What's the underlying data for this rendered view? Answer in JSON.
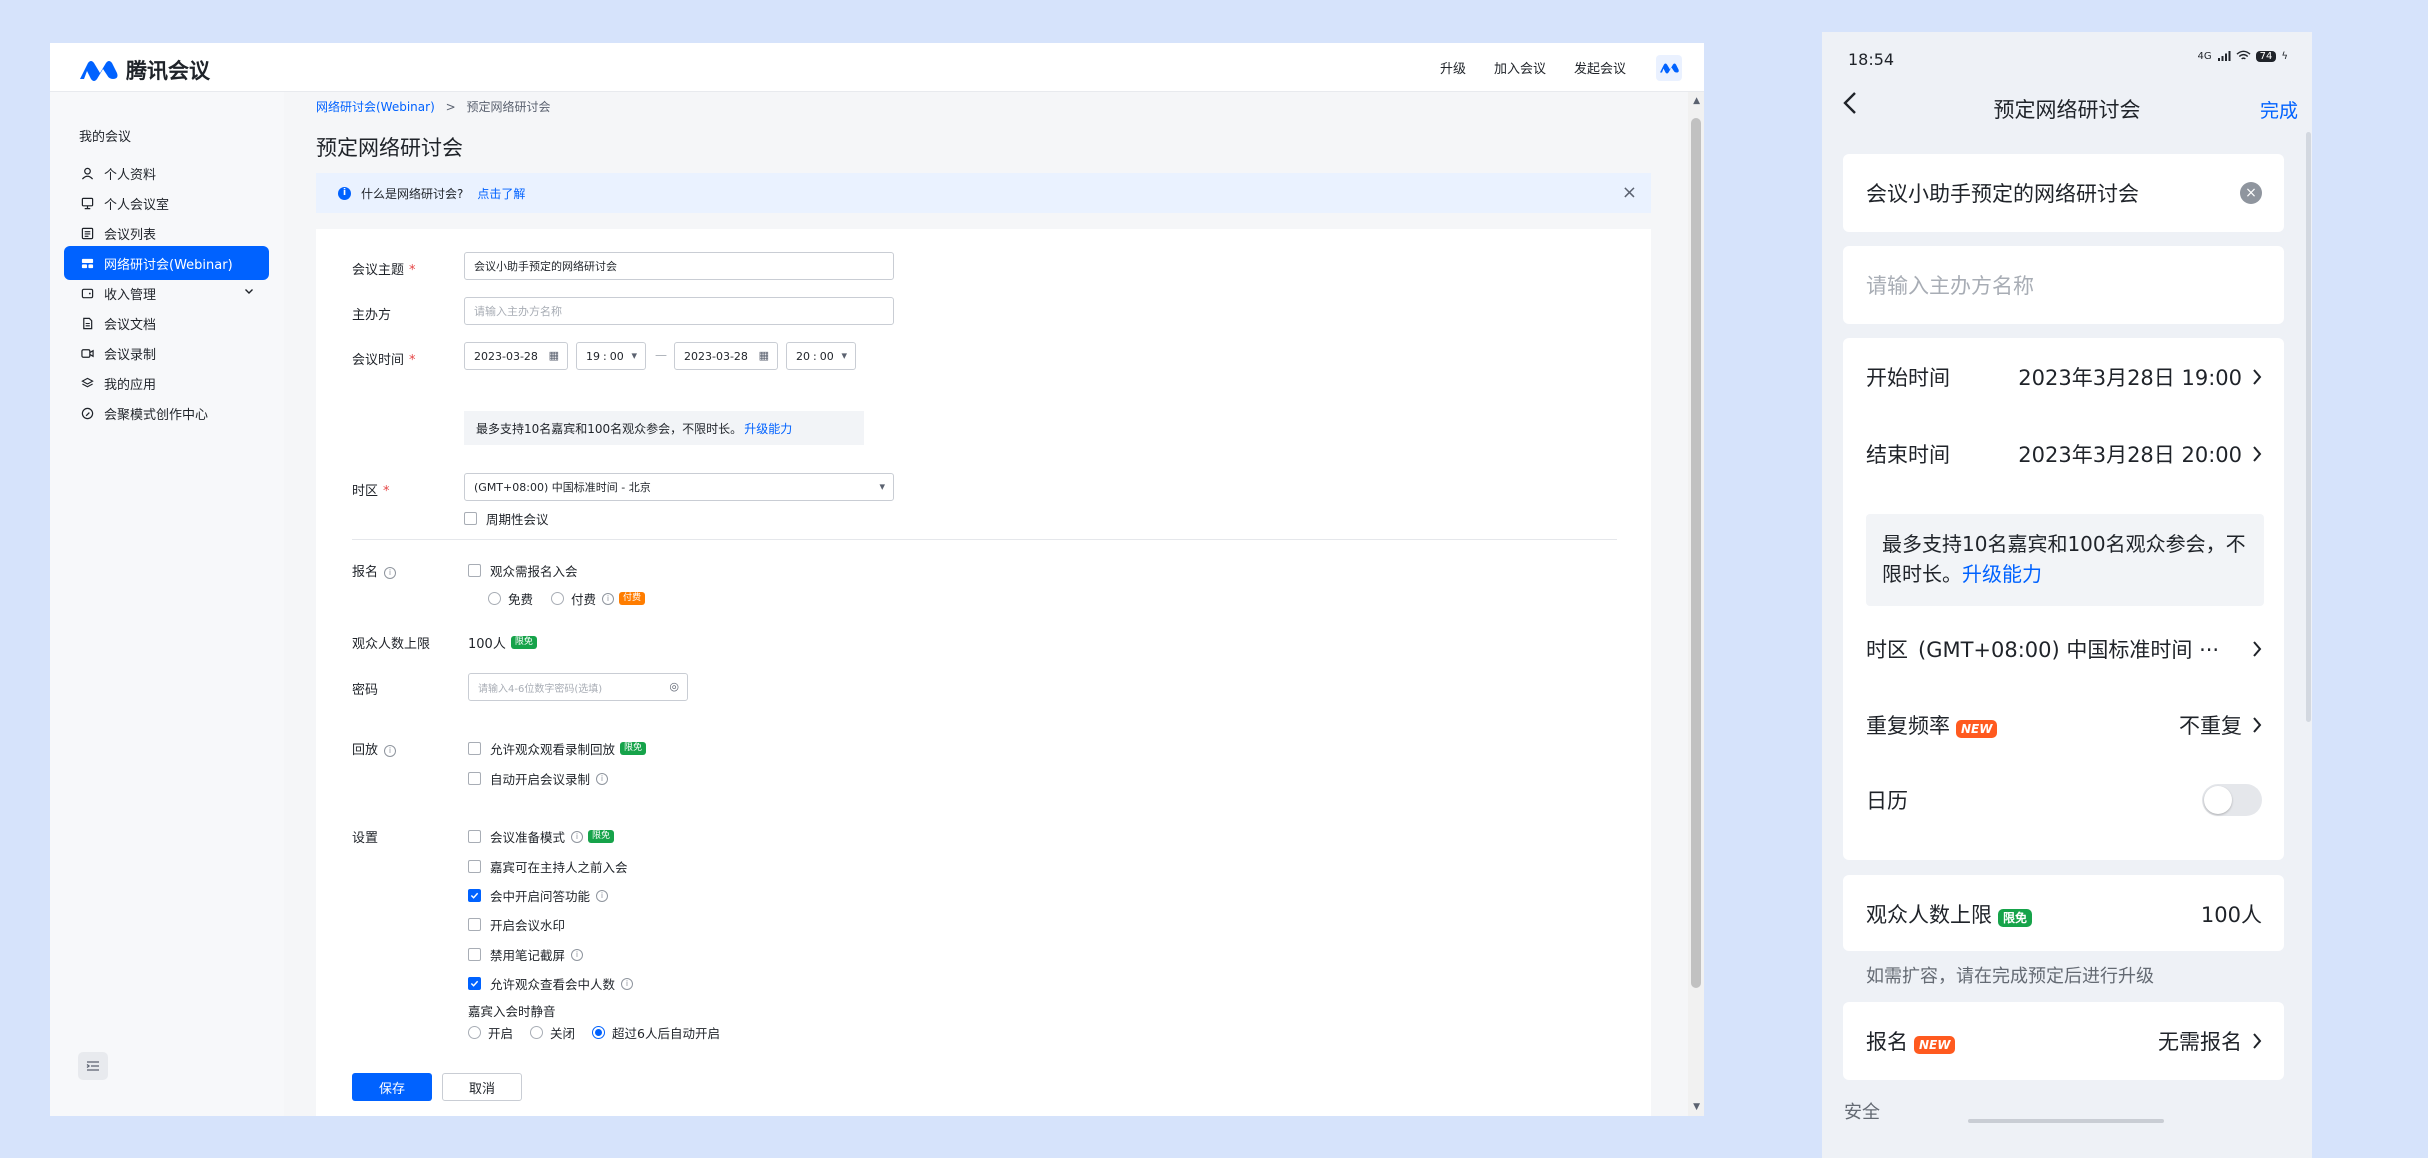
{
  "web": {
    "brand": "腾讯会议",
    "topnav": [
      "升级",
      "加入会议",
      "发起会议"
    ],
    "sidebar": {
      "title": "我的会议",
      "items": [
        {
          "label": "个人资料",
          "icon": "user-icon"
        },
        {
          "label": "个人会议室",
          "icon": "meeting-room-icon"
        },
        {
          "label": "会议列表",
          "icon": "list-icon"
        },
        {
          "label": "网络研讨会(Webinar)",
          "icon": "webinar-icon",
          "active": true
        },
        {
          "label": "收入管理",
          "icon": "wallet-icon"
        },
        {
          "label": "会议文档",
          "icon": "document-icon"
        },
        {
          "label": "会议录制",
          "icon": "recording-icon"
        },
        {
          "label": "我的应用",
          "icon": "apps-icon"
        },
        {
          "label": "会聚模式创作中心",
          "icon": "creation-icon"
        }
      ]
    },
    "breadcrumb": {
      "parent": "网络研讨会(Webinar)",
      "separator": ">",
      "current": "预定网络研讨会"
    },
    "page_title": "预定网络研讨会",
    "notice": {
      "text": "什么是网络研讨会?",
      "link": "点击了解",
      "close": "×"
    },
    "form": {
      "subject": {
        "label": "会议主题",
        "value": "会议小助手预定的网络研讨会"
      },
      "host": {
        "label": "主办方",
        "placeholder": "请输入主办方名称"
      },
      "time": {
        "label": "会议时间",
        "start_date": "2023-03-28",
        "start_hour": "19",
        "start_min": "00",
        "end_date": "2023-03-28",
        "end_hour": "20",
        "end_min": "00",
        "separator": "—",
        "colon": ":"
      },
      "limit_tip": {
        "text": "最多支持10名嘉宾和100名观众参会，不限时长。",
        "link": "升级能力"
      },
      "timezone": {
        "label": "时区",
        "value": "(GMT+08:00) 中国标准时间 - 北京"
      },
      "recurring": "周期性会议",
      "registration": {
        "label": "报名",
        "option": "观众需报名入会",
        "free": "免费",
        "paid": "付费",
        "paid_tag": "付费"
      },
      "audience_limit": {
        "label": "观众人数上限",
        "value": "100人",
        "tag": "限免"
      },
      "password": {
        "label": "密码",
        "placeholder": "请输入4-6位数字密码(选填)"
      },
      "playback": {
        "label": "回放",
        "allow": "允许观众观看录制回放",
        "allow_tag": "限免",
        "auto_record": "自动开启会议录制"
      },
      "settings": {
        "label": "设置",
        "items": [
          {
            "label": "会议准备模式",
            "checked": false,
            "info": true,
            "tag": "限免"
          },
          {
            "label": "嘉宾可在主持人之前入会",
            "checked": false
          },
          {
            "label": "会中开启问答功能",
            "checked": true,
            "info": true
          },
          {
            "label": "开启会议水印",
            "checked": false
          },
          {
            "label": "禁用笔记截屏",
            "checked": false,
            "info": true
          },
          {
            "label": "允许观众查看会中人数",
            "checked": true,
            "info": true
          }
        ],
        "mute_label": "嘉宾入会时静音",
        "mute_options": [
          {
            "label": "开启",
            "selected": false
          },
          {
            "label": "关闭",
            "selected": false
          },
          {
            "label": "超过6人后自动开启",
            "selected": true
          }
        ]
      },
      "save": "保存",
      "cancel": "取消"
    }
  },
  "phone": {
    "status_time": "18:54",
    "status_battery": "74",
    "status_net": "4G",
    "title": "预定网络研讨会",
    "done": "完成",
    "subject": "会议小助手预定的网络研讨会",
    "host_placeholder": "请输入主办方名称",
    "start": {
      "label": "开始时间",
      "value": "2023年3月28日 19:00"
    },
    "end": {
      "label": "结束时间",
      "value": "2023年3月28日 20:00"
    },
    "tip": {
      "text": "最多支持10名嘉宾和100名观众参会，不限时长。",
      "link": "升级能力"
    },
    "timezone": {
      "label": "时区",
      "value": "(GMT+08:00) 中国标准时间 ···"
    },
    "repeat": {
      "label": "重复频率",
      "tag": "NEW",
      "value": "不重复"
    },
    "calendar": {
      "label": "日历",
      "on": false
    },
    "audience": {
      "label": "观众人数上限",
      "tag": "限免",
      "value": "100人"
    },
    "audience_note": "如需扩容，请在完成预定后进行升级",
    "registration": {
      "label": "报名",
      "tag": "NEW",
      "value": "无需报名"
    },
    "security": "安全"
  }
}
